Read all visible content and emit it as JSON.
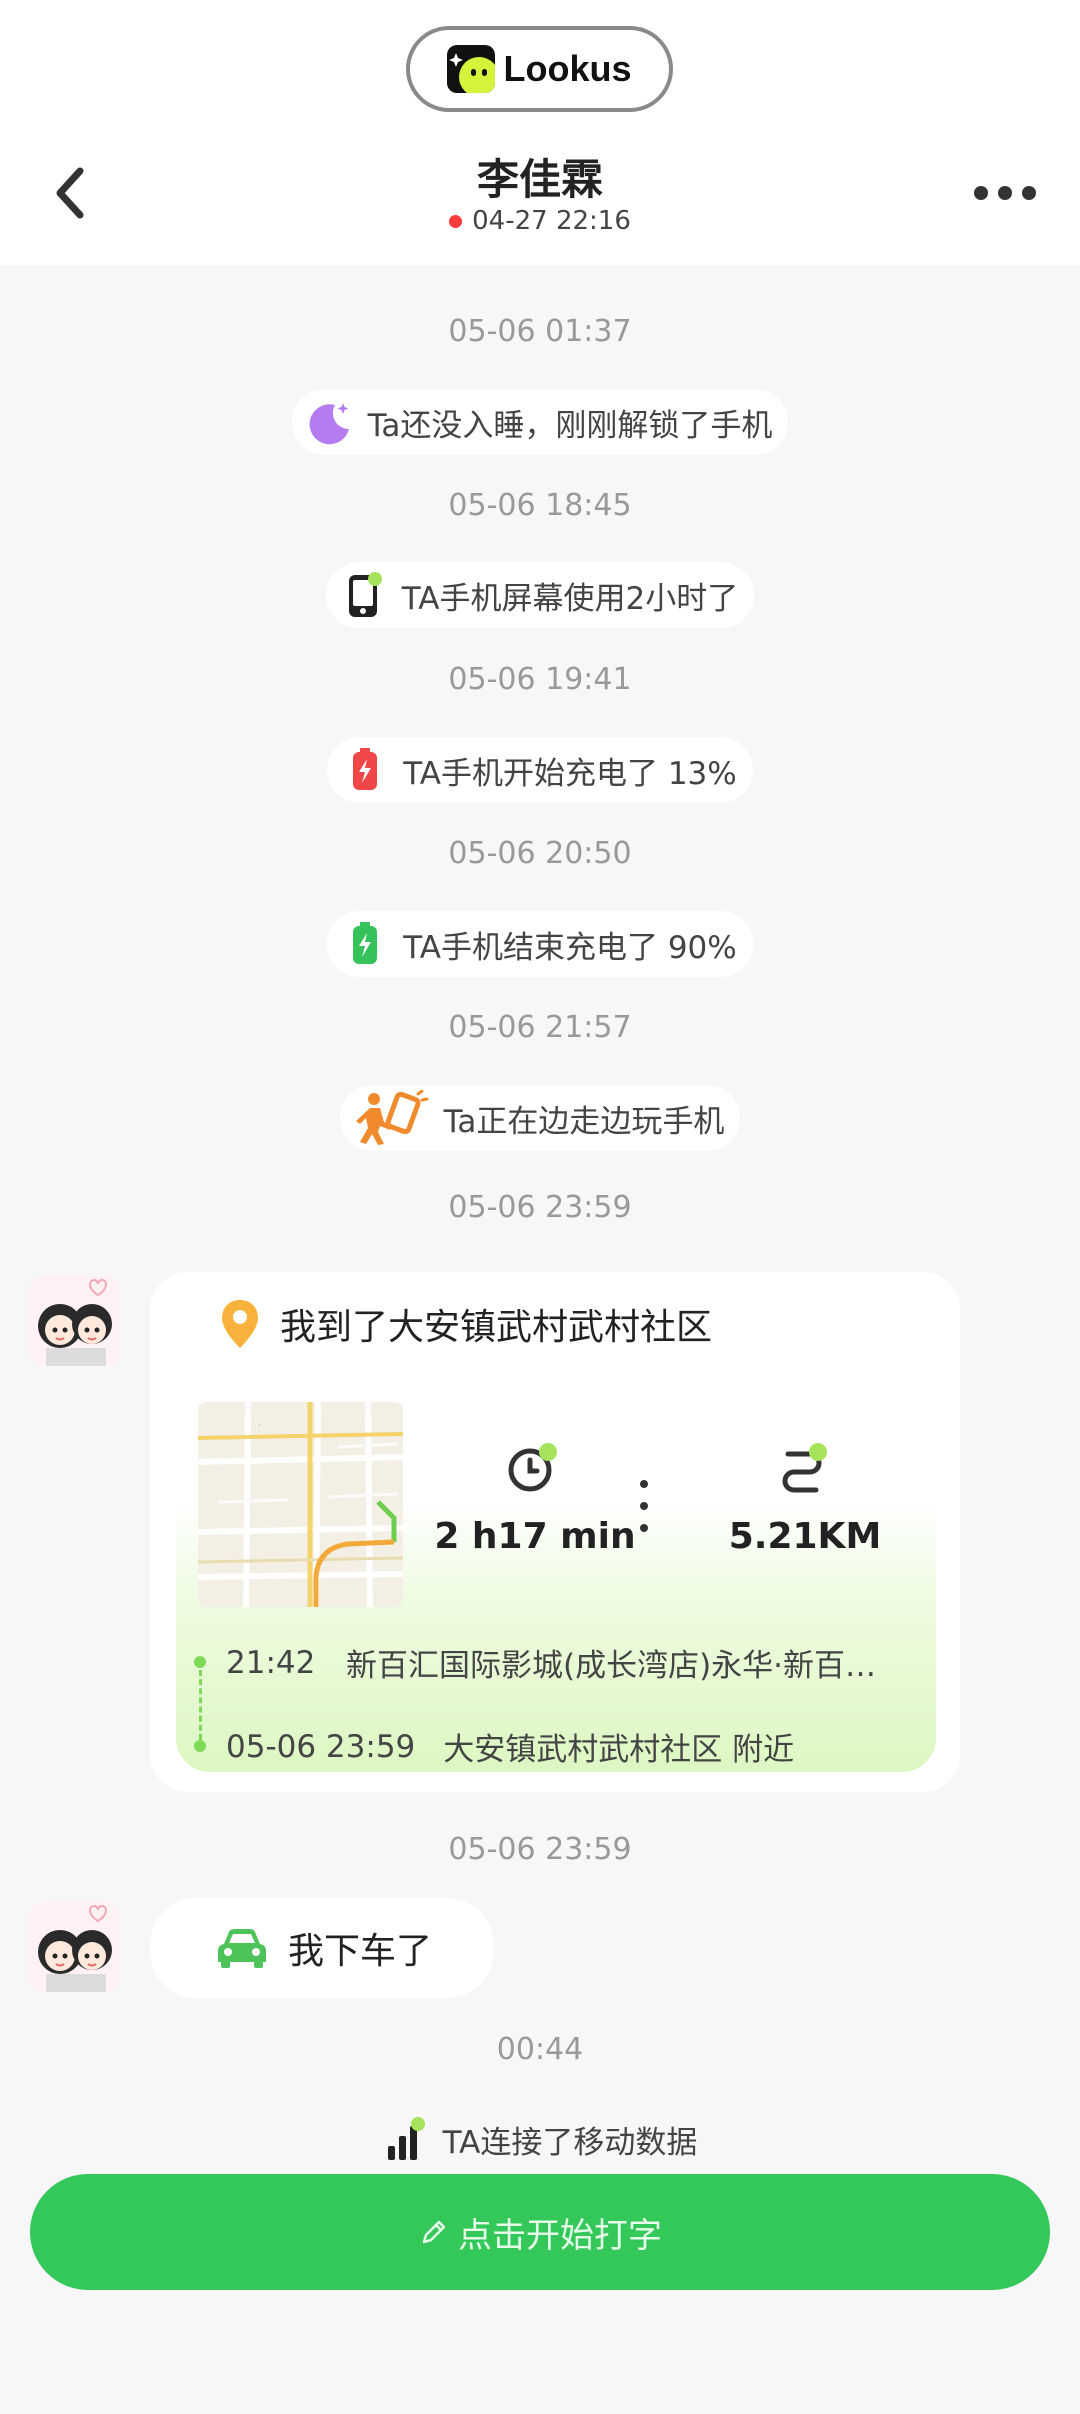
{
  "brand": {
    "name": "Lookus"
  },
  "header": {
    "contact_name": "李佳霖",
    "last_seen": "04-27 22:16"
  },
  "timeline": {
    "ts1": "05-06 01:37",
    "ev1": "Ta还没入睡，刚刚解锁了手机",
    "ts2": "05-06 18:45",
    "ev2": "TA手机屏幕使用2小时了",
    "ts3": "05-06 19:41",
    "ev3": "TA手机开始充电了 13%",
    "ts4": "05-06 20:50",
    "ev4": "TA手机结束充电了 90%",
    "ts5": "05-06 21:57",
    "ev5": "Ta正在边走边玩手机",
    "ts6": "05-06 23:59",
    "ts7": "05-06 23:59",
    "ts8": "00:44",
    "ev8": "TA连接了移动数据"
  },
  "location_card": {
    "title": "我到了大安镇武村武村社区",
    "duration": "2 h17 min",
    "distance": "5.21KM",
    "from_time": "21:42",
    "from_place": "新百汇国际影城(成长湾店)永华·新百…",
    "to_time": "05-06 23:59",
    "to_place": "大安镇武村武村社区 附近"
  },
  "car_message": {
    "text": "我下车了"
  },
  "compose": {
    "label": "点击开始打字"
  },
  "colors": {
    "accent_green": "#34c759",
    "route_green": "#7ed957",
    "status_red": "#ff3b3b",
    "moon_purple": "#b57cf2",
    "pin_orange": "#f6b23a"
  }
}
